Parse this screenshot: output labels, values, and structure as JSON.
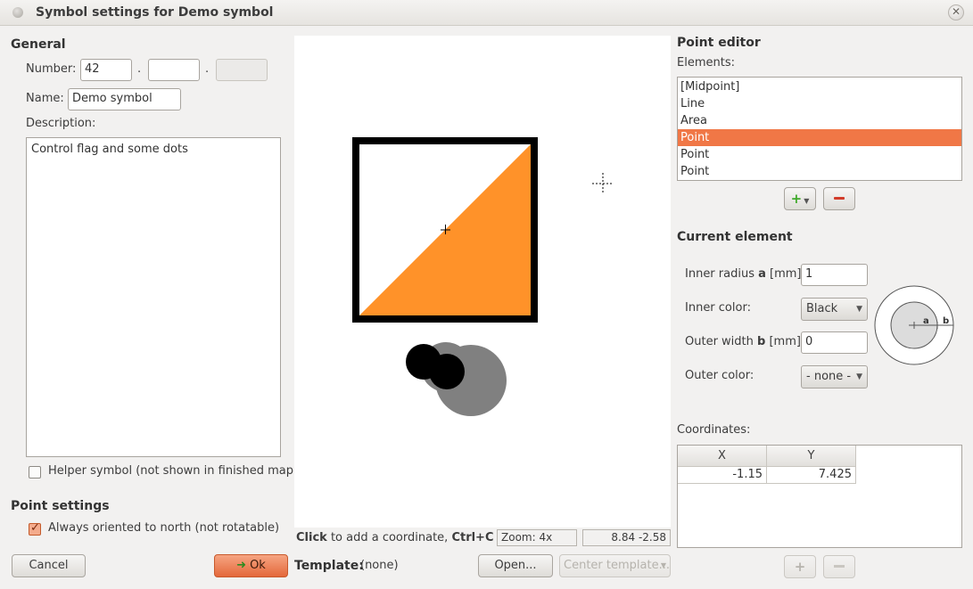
{
  "window": {
    "title": "Symbol settings for Demo symbol"
  },
  "general": {
    "heading": "General",
    "number_label": "Number:",
    "number_part1": "42",
    "number_part2": "",
    "number_part3": "",
    "number_sep": ".",
    "name_label": "Name:",
    "name_value": "Demo symbol",
    "description_label": "Description:",
    "description_value": "Control flag and some dots",
    "helper_symbol_label": "Helper symbol (not shown in finished map)",
    "helper_symbol_checked": false
  },
  "point_settings": {
    "heading": "Point settings",
    "oriented_label": "Always oriented to north (not rotatable)",
    "oriented_checked": true
  },
  "canvas": {
    "status_hint_bold1": "Click",
    "status_hint_text1": " to add a coordinate, ",
    "status_hint_bold2": "Ctrl+Click",
    "zoom": "Zoom: 4x",
    "cursor_coords": "8.84 -2.58",
    "colors": {
      "flag_orange": "#ff9229",
      "outline": "#000000",
      "gray_dot": "#808080"
    }
  },
  "point_editor": {
    "heading": "Point editor",
    "elements_label": "Elements:",
    "elements": [
      "[Midpoint]",
      "Line",
      "Area",
      "Point",
      "Point",
      "Point"
    ],
    "selected_index": 3,
    "add_button_icon": "plus-icon",
    "remove_button_icon": "minus-icon"
  },
  "current_element": {
    "heading": "Current element",
    "inner_radius_label_pre": "Inner radius ",
    "inner_radius_label_bold": "a",
    "inner_radius_label_post": " [mm]:",
    "inner_radius_value": "1",
    "inner_color_label": "Inner color:",
    "inner_color_value": "Black",
    "outer_width_label_pre": "Outer width ",
    "outer_width_label_bold": "b",
    "outer_width_label_post": " [mm]:",
    "outer_width_value": "0",
    "outer_color_label": "Outer color:",
    "outer_color_value": "- none -",
    "diagram_a": "a",
    "diagram_b": "b"
  },
  "coordinates": {
    "label": "Coordinates:",
    "columns": [
      "X",
      "Y"
    ],
    "rows": [
      [
        "-1.15",
        "7.425"
      ]
    ]
  },
  "footer": {
    "cancel_label": "Cancel",
    "ok_label": "Ok",
    "template_label": "Template:",
    "template_value": "(none)",
    "open_label": "Open...",
    "center_template_label": "Center template...",
    "accent_color": "#f07746"
  }
}
